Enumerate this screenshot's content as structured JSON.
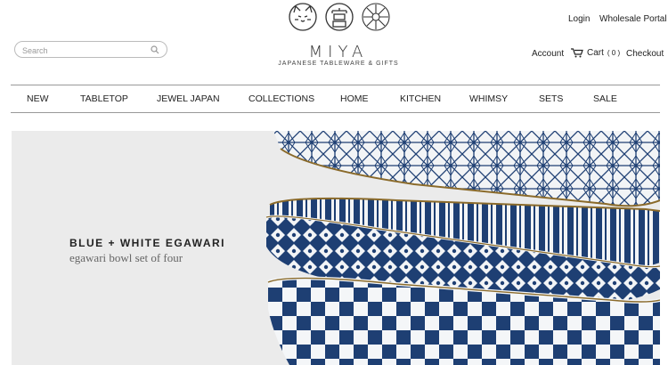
{
  "header": {
    "brand_name": "MIYA",
    "tagline": "JAPANESE TABLEWARE & GIFTS",
    "logo_icons": [
      "cat-icon",
      "kanji-seal-icon",
      "chrysanthemum-icon"
    ],
    "search": {
      "placeholder": "Search"
    },
    "top_links": {
      "login": "Login",
      "wholesale": "Wholesale Portal"
    },
    "account_links": {
      "account": "Account",
      "cart": "Cart",
      "cart_count": "( 0 )",
      "checkout": "Checkout"
    }
  },
  "nav": {
    "items": [
      "NEW",
      "TABLETOP",
      "JEWEL JAPAN",
      "COLLECTIONS",
      "HOME",
      "KITCHEN",
      "WHIMSY",
      "SETS",
      "SALE"
    ]
  },
  "hero": {
    "title": "BLUE + WHITE EGAWARI",
    "subtitle": "egawari bowl set of four"
  },
  "colors": {
    "accent_blue": "#1e3f73",
    "hero_bg": "#ebebeb",
    "rim_gold": "#8a6a2a"
  }
}
